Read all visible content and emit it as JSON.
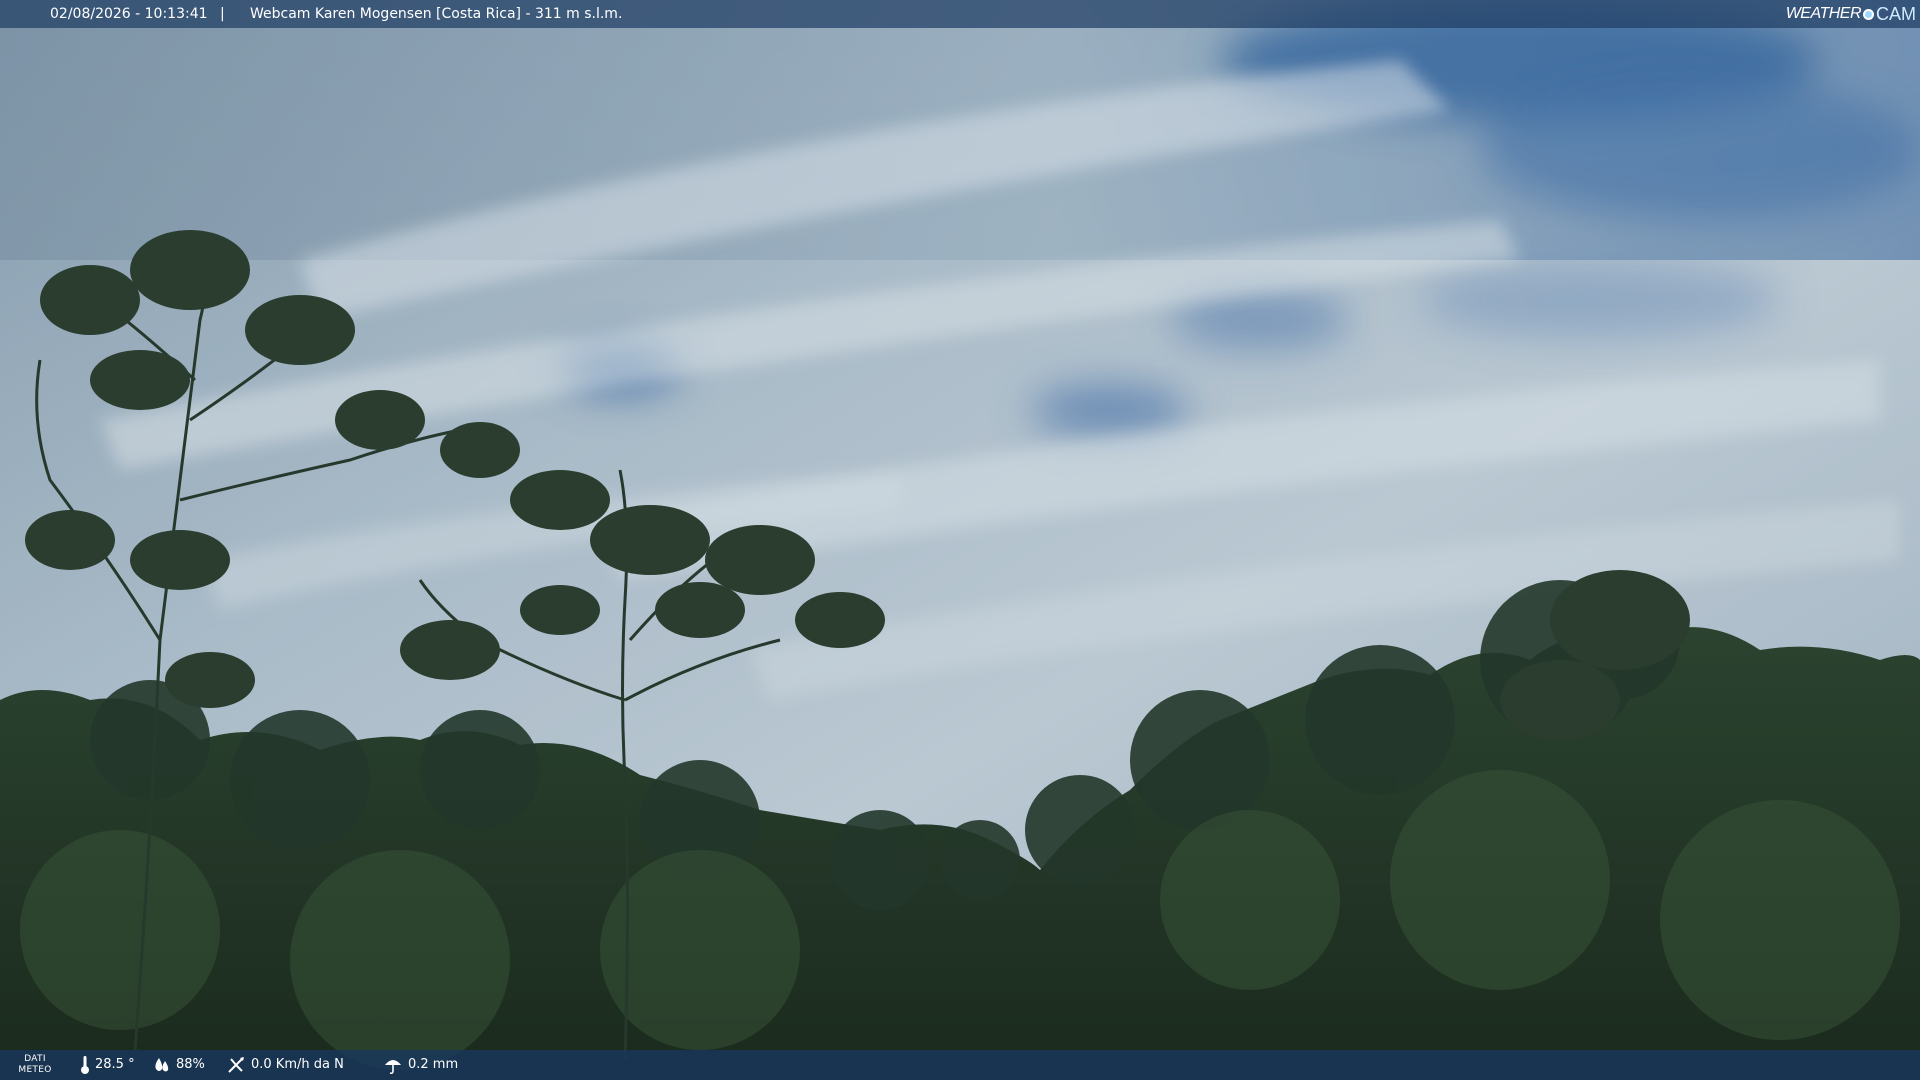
{
  "header": {
    "datetime": "02/08/2026 - 10:13:41",
    "separator": "|",
    "title": "Webcam Karen Mogensen [Costa Rica]  - 311 m s.l.m."
  },
  "logo": {
    "part1": "WEATHER",
    "part2": "CAM"
  },
  "weather": {
    "label_line1": "DATI",
    "label_line2": "METEO",
    "temperature": "28.5 °",
    "humidity": "88%",
    "wind": "0.0 Km/h da N",
    "rain": "0.2 mm",
    "icons": {
      "temperature": "thermometer-icon",
      "humidity": "humidity-drops-icon",
      "wind": "wind-direction-icon",
      "rain": "rain-umbrella-icon"
    }
  },
  "colors": {
    "header_bar": "#203e64",
    "footer_bar": "#18375f",
    "sky_light": "#e3ecf2",
    "sky_blue": "#4f7fb8",
    "foliage_dark": "#1f3120"
  }
}
